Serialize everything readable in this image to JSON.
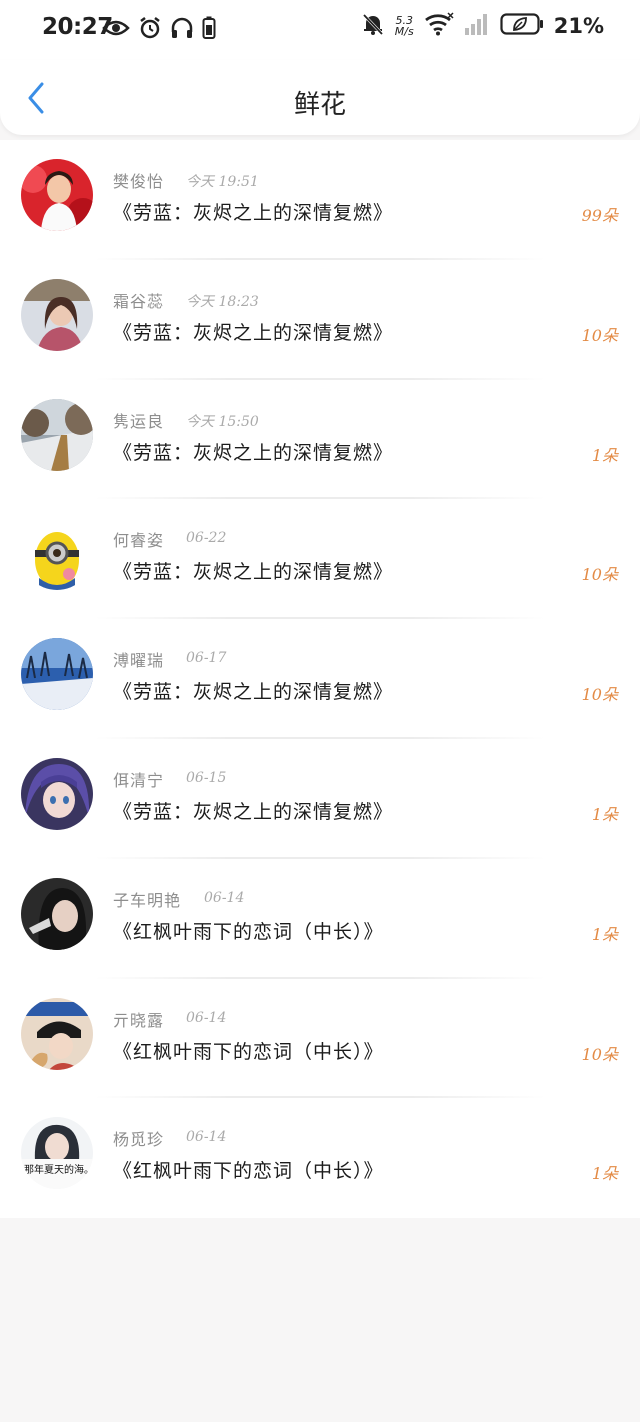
{
  "status_bar": {
    "time": "20:27",
    "net_speed_value": "5.3",
    "net_speed_unit": "M/s",
    "battery_percent": "21%"
  },
  "header": {
    "title": "鲜花"
  },
  "records": [
    {
      "name": "樊俊怡",
      "time": "今天 19:51",
      "work": "《劳蓝：灰烬之上的深情复燃》",
      "flowers": "99朵"
    },
    {
      "name": "霜谷蕊",
      "time": "今天 18:23",
      "work": "《劳蓝：灰烬之上的深情复燃》",
      "flowers": "10朵"
    },
    {
      "name": "隽运良",
      "time": "今天 15:50",
      "work": "《劳蓝：灰烬之上的深情复燃》",
      "flowers": "1朵"
    },
    {
      "name": "何睿姿",
      "time": "06-22",
      "work": "《劳蓝：灰烬之上的深情复燃》",
      "flowers": "10朵"
    },
    {
      "name": "溥曜瑞",
      "time": "06-17",
      "work": "《劳蓝：灰烬之上的深情复燃》",
      "flowers": "10朵"
    },
    {
      "name": "佴清宁",
      "time": "06-15",
      "work": "《劳蓝：灰烬之上的深情复燃》",
      "flowers": "1朵"
    },
    {
      "name": "子车明艳",
      "time": "06-14",
      "work": "《红枫叶雨下的恋词（中长）》",
      "flowers": "1朵"
    },
    {
      "name": "亓晓露",
      "time": "06-14",
      "work": "《红枫叶雨下的恋词（中长）》",
      "flowers": "10朵"
    },
    {
      "name": "杨觅珍",
      "time": "06-14",
      "work": "《红枫叶雨下的恋词（中长）》",
      "flowers": "1朵"
    }
  ],
  "avatar_overlay_text": "那年夏天的海。",
  "colors": {
    "accent_blue": "#3a8ee6",
    "flower_orange": "#e38b46",
    "name_gray": "#8e8e8e"
  }
}
